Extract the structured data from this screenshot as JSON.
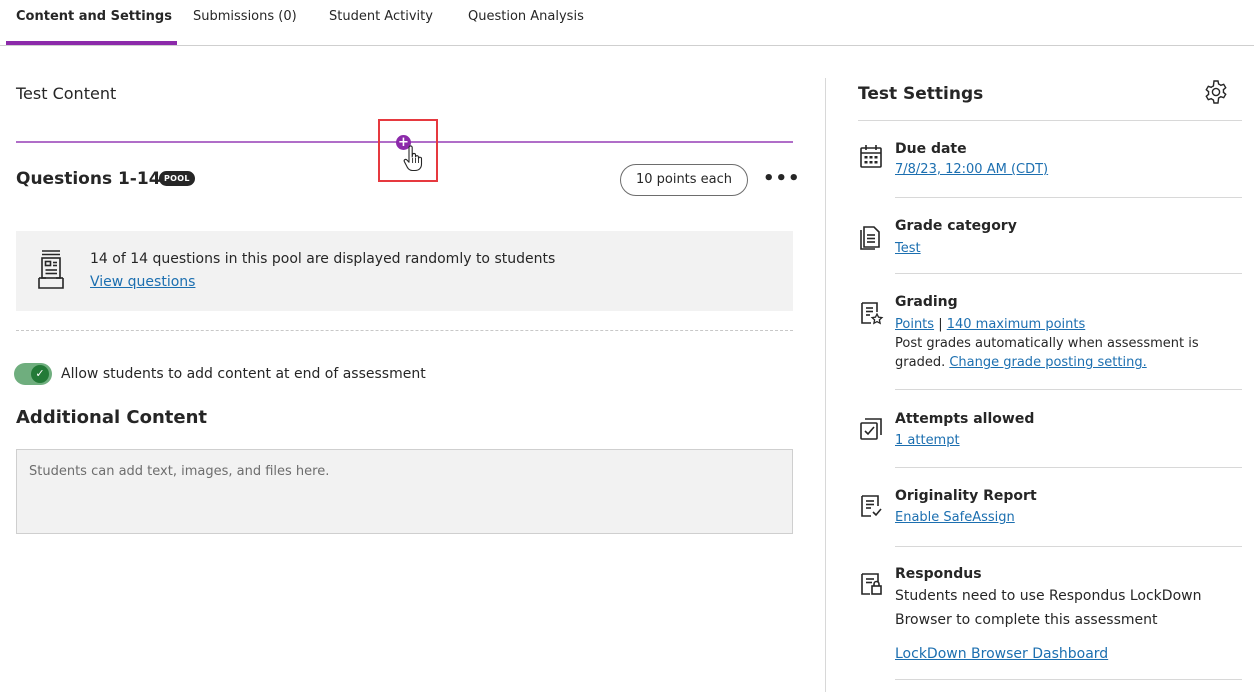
{
  "tabs": [
    {
      "label": "Content and Settings"
    },
    {
      "label": "Submissions (0)"
    },
    {
      "label": "Student Activity"
    },
    {
      "label": "Question Analysis"
    }
  ],
  "main": {
    "heading": "Test Content",
    "add_icon": "plus-circle-icon",
    "question_block": {
      "title": "Questions 1-14",
      "badge": "POOL",
      "points": "10 points each",
      "more": "•••",
      "pool_text": "14 of 14 questions in this pool are displayed randomly to students",
      "view_link": "View questions"
    },
    "toggle": {
      "on": true,
      "label": "Allow students to add content at end of assessment"
    },
    "additional": {
      "heading": "Additional Content",
      "placeholder": "Students can add text, images, and files here."
    }
  },
  "settings": {
    "heading": "Test Settings",
    "gear_icon": "gear-icon",
    "due": {
      "title": "Due date",
      "value": "7/8/23, 12:00 AM (CDT)"
    },
    "grade_category": {
      "title": "Grade category",
      "value": "Test"
    },
    "grading": {
      "title": "Grading",
      "points_link": "Points",
      "separator": "|",
      "max_link": "140 maximum points",
      "desc_line1": "Post grades automatically when assessment is",
      "desc_line2": "graded.",
      "change_link": "Change grade posting setting."
    },
    "attempts": {
      "title": "Attempts allowed",
      "value": "1 attempt"
    },
    "originality": {
      "title": "Originality Report",
      "value": "Enable SafeAssign"
    },
    "respondus": {
      "title": "Respondus",
      "line1": "Students need to use Respondus LockDown",
      "line2": "Browser to complete this assessment",
      "link": "LockDown Browser Dashboard"
    }
  },
  "colors": {
    "accent": "#8c2aaa",
    "link": "#1c6fb0",
    "toggle_on": "#237a37",
    "highlight_box": "#e6393f"
  }
}
